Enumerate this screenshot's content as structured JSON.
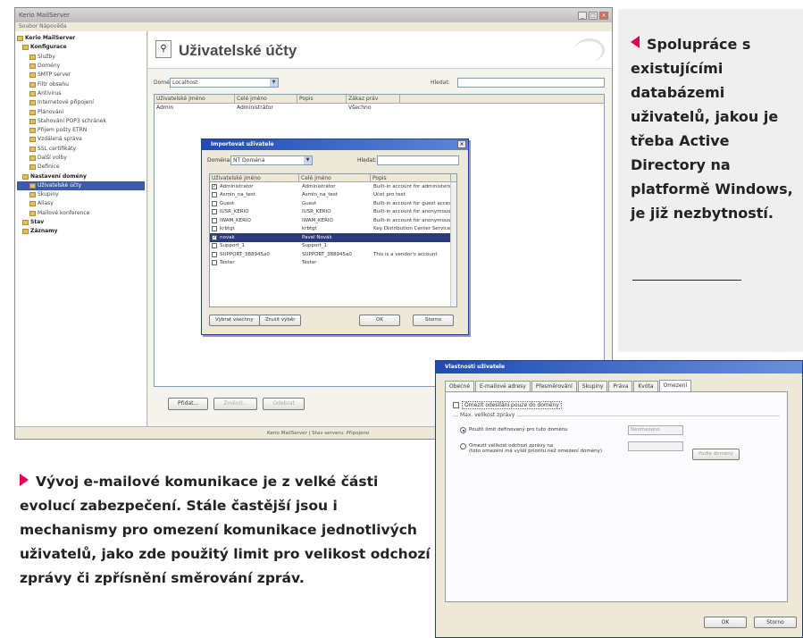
{
  "main_window": {
    "title": "Kerio MailServer",
    "menu": "Soubor  Nápověda",
    "controls": [
      "_",
      "□",
      "×"
    ],
    "tree": [
      {
        "label": "Kerio MailServer",
        "style": "bold"
      },
      {
        "label": "Konfigurace",
        "style": "bold"
      },
      {
        "label": "Služby",
        "style": ""
      },
      {
        "label": "Domény",
        "style": ""
      },
      {
        "label": "SMTP server",
        "style": ""
      },
      {
        "label": "Filtr obsahu",
        "style": ""
      },
      {
        "label": "Antivirus",
        "style": ""
      },
      {
        "label": "Internetové připojení",
        "style": ""
      },
      {
        "label": "Plánování",
        "style": ""
      },
      {
        "label": "Stahování POP3 schránek",
        "style": ""
      },
      {
        "label": "Přijem pošty ETRN",
        "style": ""
      },
      {
        "label": "Vzdálená správa",
        "style": ""
      },
      {
        "label": "SSL certifikáty",
        "style": ""
      },
      {
        "label": "Další volby",
        "style": ""
      },
      {
        "label": "Definice",
        "style": ""
      },
      {
        "label": "Nastavení domény",
        "style": "bold"
      },
      {
        "label": "Uživatelské účty",
        "style": "selected"
      },
      {
        "label": "Skupiny",
        "style": ""
      },
      {
        "label": "Aliasy",
        "style": ""
      },
      {
        "label": "Mailové konference",
        "style": ""
      },
      {
        "label": "Stav",
        "style": "bold"
      },
      {
        "label": "Záznamy",
        "style": "bold"
      }
    ],
    "page_title": "Uživatelské účty",
    "filter": {
      "label": "Doména:",
      "value": "Localhost",
      "search_label": "Hledat:",
      "search_value": ""
    },
    "columns": [
      "Uživatelské jméno",
      "Celé jméno",
      "Popis",
      "Zákaz práv"
    ],
    "rows": [
      [
        "Admin",
        "Administrátor",
        "",
        "Všechno"
      ]
    ],
    "buttons": {
      "add": "Přidat...",
      "edit": "Změnit...",
      "remove": "Odebrat"
    },
    "status": "Kerio MailServer | Stav serveru: Připojeno"
  },
  "select_dialog": {
    "title": "Importovat uživatele",
    "filter_label": "Doména:",
    "filter_value": "NT Doména",
    "search_label": "Hledat:",
    "columns": [
      "Uživatelské jméno",
      "Celé jméno",
      "Popis"
    ],
    "rows": [
      {
        "name": "Administrator",
        "full": "Administrátor",
        "desc": "Built-in account for administering",
        "checked": true,
        "selected": false
      },
      {
        "name": "Asmin_na_test",
        "full": "Asmin_na_test",
        "desc": "Účet pro test",
        "checked": false,
        "selected": false
      },
      {
        "name": "Guest",
        "full": "Guest",
        "desc": "Built-in account for guest access",
        "checked": false,
        "selected": false
      },
      {
        "name": "IUSR_KERIO",
        "full": "IUSR_KERIO",
        "desc": "Built-in account for anonymous",
        "checked": false,
        "selected": false
      },
      {
        "name": "IWAM_KERIO",
        "full": "IWAM_KERIO",
        "desc": "Built-in account for anonymous",
        "checked": false,
        "selected": false
      },
      {
        "name": "krbtgt",
        "full": "krbtgt",
        "desc": "Key Distribution Center Service",
        "checked": false,
        "selected": false
      },
      {
        "name": "novak",
        "full": "Pavel Novák",
        "desc": "",
        "checked": true,
        "selected": true
      },
      {
        "name": "Support_1",
        "full": "Support_1",
        "desc": "",
        "checked": false,
        "selected": false
      },
      {
        "name": "SUPPORT_388945a0",
        "full": "SUPPORT_388945a0",
        "desc": "This is a vendor's account",
        "checked": false,
        "selected": false
      },
      {
        "name": "Tester",
        "full": "Tester",
        "desc": "",
        "checked": false,
        "selected": false
      }
    ],
    "btn_all": "Vybrat všechny",
    "btn_none": "Zrušit výběr",
    "ok": "OK",
    "cancel": "Storno",
    "close": "×"
  },
  "callout_right": {
    "text": "Spolupráce s existujícími databázemi uživatelů, jakou je třeba Active Directory na platformě Windows, je již nezbytností.",
    "accent": "#e0005a"
  },
  "caption_bottom": {
    "text": "Vývoj e-mailové komunikace je z velké části evolucí zabezpečení. Stále častější jsou i mechanismy pro omezení komunikace jednotlivých uživatelů, jako zde použitý limit pro velikost odchozí zprávy či zpřísnění směrování zpráv.",
    "accent": "#e0005a"
  },
  "props_dialog": {
    "title": "Vlastnosti uživatele",
    "tabs": [
      "Obecné",
      "E-mailové adresy",
      "Přesměrování",
      "Skupiny",
      "Práva",
      "Kvóta",
      "Omezení"
    ],
    "active_tab": 6,
    "checkbox_label": "Omezit odesílání pouze do domény",
    "group_title": "Max. velikost zprávy",
    "radio1": "Použít limit definovaný pro tuto doménu",
    "radio1_value": "Neomezeno",
    "radio2": "Omezit velikost odchozí zprávy na",
    "radio2_sub": "(toto omezení má vyšší prioritu než omezení domény)",
    "radio2_btn": "Podle domény",
    "ok": "OK",
    "cancel": "Storno"
  }
}
